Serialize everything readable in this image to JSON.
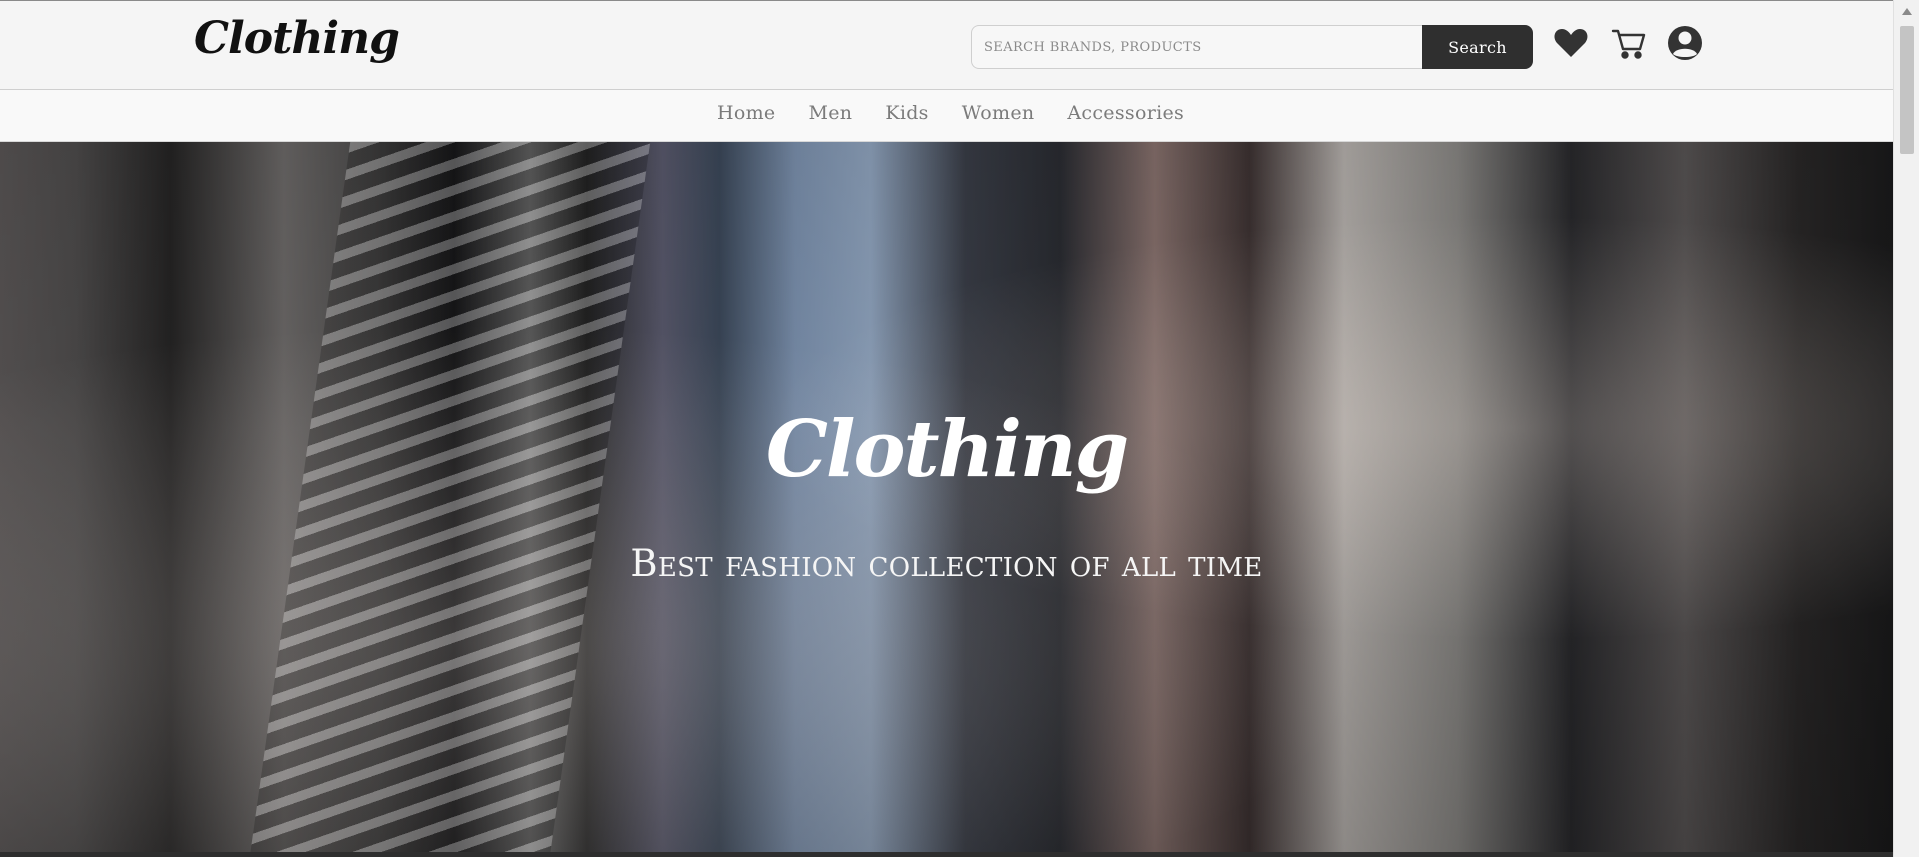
{
  "header": {
    "logo_text": "Clothing",
    "search": {
      "placeholder": "SEARCH BRANDS, PRODUCTS",
      "button_label": "Search"
    },
    "icons": [
      "heart-icon",
      "cart-icon",
      "user-icon"
    ]
  },
  "nav": {
    "items": [
      {
        "label": "Home"
      },
      {
        "label": "Men"
      },
      {
        "label": "Kids"
      },
      {
        "label": "Women"
      },
      {
        "label": "Accessories"
      }
    ]
  },
  "hero": {
    "logo_text": "Clothing",
    "tagline": "Best fashion collection of all time"
  },
  "colors": {
    "search_button": "#2f2f2f",
    "nav_text": "#7b7b7b",
    "background": "#f6f6f6"
  }
}
